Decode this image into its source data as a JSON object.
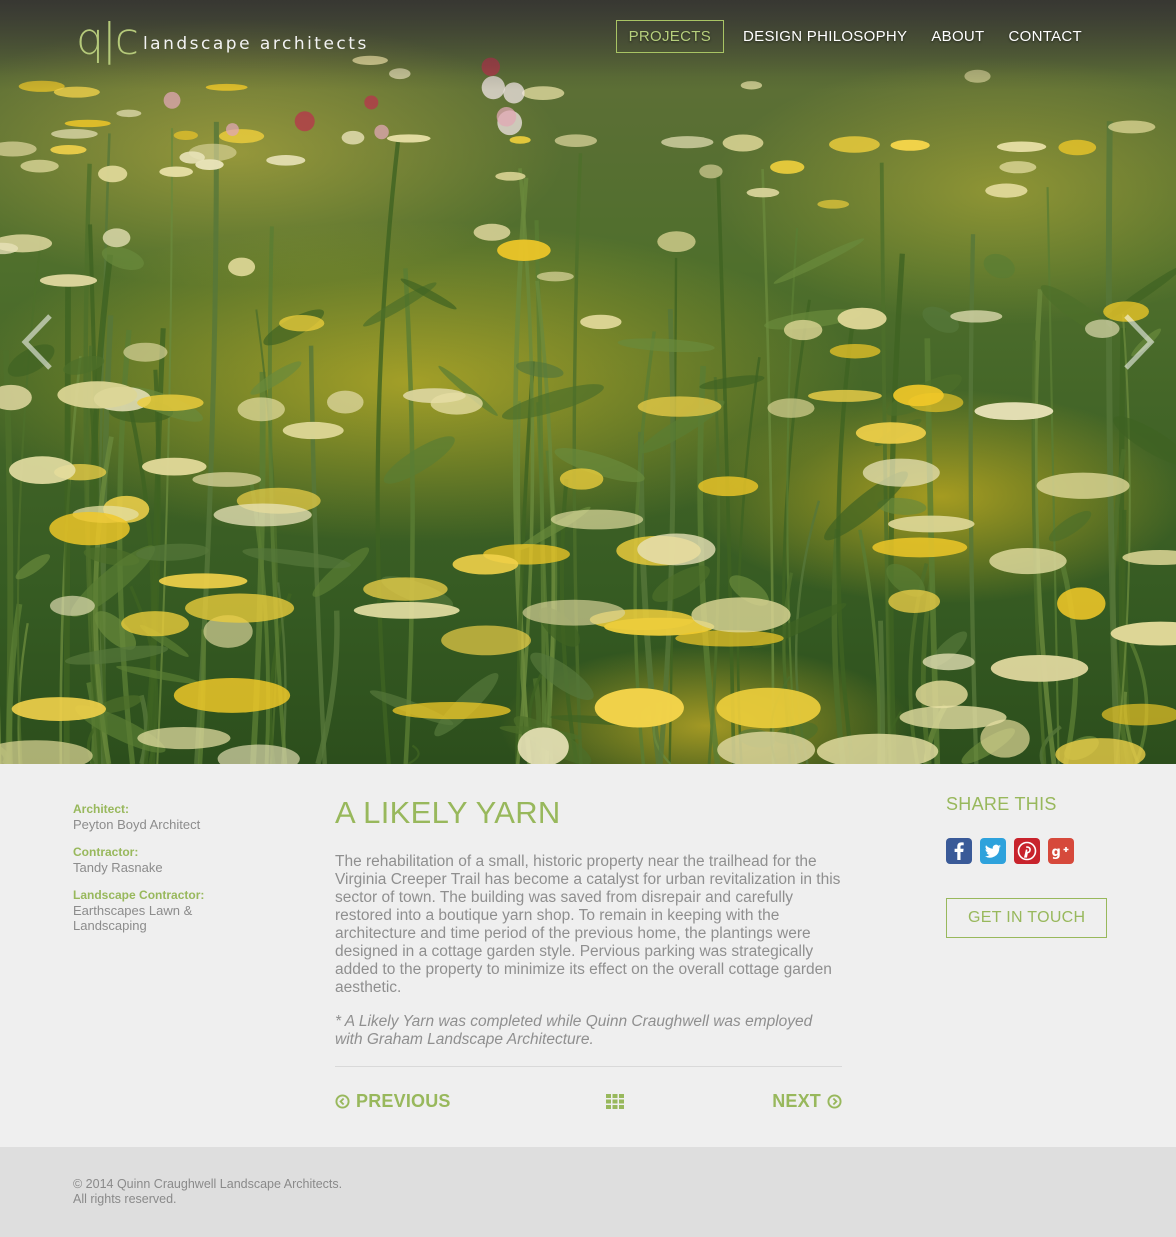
{
  "brand": {
    "mark": "q|c",
    "name": "landscape architects",
    "accent_color": "#98b85c"
  },
  "nav": {
    "items": [
      "PROJECTS",
      "DESIGN PHILOSOPHY",
      "ABOUT",
      "CONTACT"
    ],
    "active": "PROJECTS"
  },
  "hero": {
    "left_arrow_icon": "chevron-left-icon",
    "right_arrow_icon": "chevron-right-icon"
  },
  "credits": [
    {
      "label": "Architect:",
      "value": "Peyton Boyd Architect"
    },
    {
      "label": "Contractor:",
      "value": "Tandy Rasnake"
    },
    {
      "label": "Landscape Contractor:",
      "value": "Earthscapes Lawn & Landscaping"
    }
  ],
  "project": {
    "title": "A LIKELY YARN",
    "description": "The rehabilitation of a small, historic property near the trailhead for the Virginia Creeper Trail has become a catalyst for urban revitalization in this sector of town. The building was saved from disrepair and carefully restored into a boutique yarn shop. To remain in keeping with the architecture and time period of the previous home, the plantings were designed in a cottage garden style.  Pervious parking was strategically added to the property to minimize its effect on the overall cottage garden aesthetic.",
    "note": "* A Likely Yarn was completed while Quinn Craughwell was employed with Graham Landscape Architecture."
  },
  "pager": {
    "previous_label": "PREVIOUS",
    "next_label": "NEXT",
    "grid_icon": "grid-icon"
  },
  "share": {
    "title": "SHARE THIS",
    "networks": [
      "facebook",
      "twitter",
      "pinterest",
      "google-plus"
    ],
    "cta_label": "GET IN TOUCH"
  },
  "footer": {
    "line1": "© 2014 Quinn Craughwell Landscape Architects.",
    "line2": "All rights reserved."
  }
}
